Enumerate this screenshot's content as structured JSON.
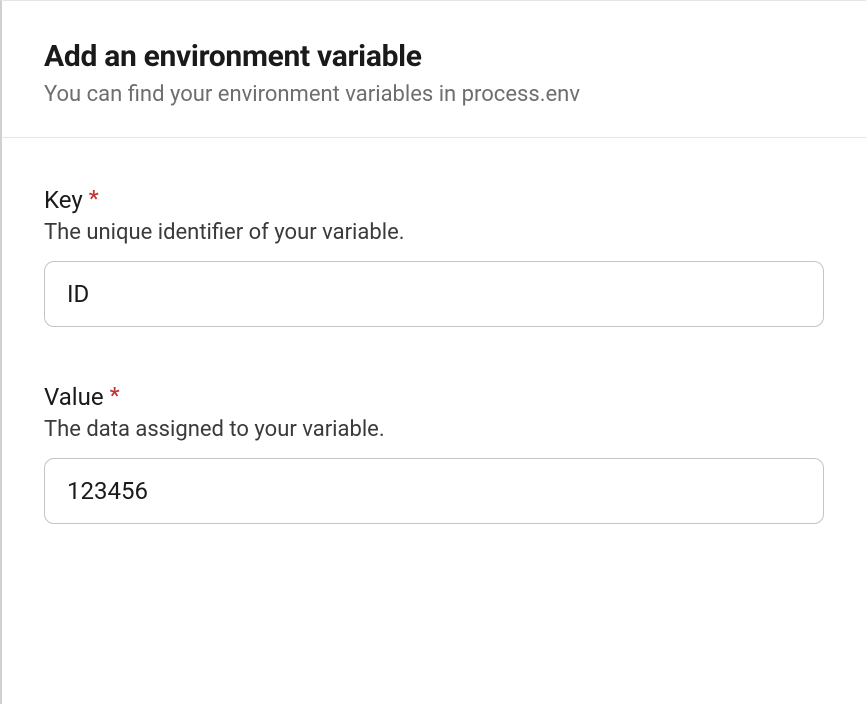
{
  "header": {
    "title": "Add an environment variable",
    "subtitle": "You can find your environment variables in process.env"
  },
  "form": {
    "key": {
      "label": "Key",
      "required_mark": "*",
      "description": "The unique identifier of your variable.",
      "value": "ID"
    },
    "value": {
      "label": "Value",
      "required_mark": "*",
      "description": "The data assigned to your variable.",
      "value": "123456"
    }
  }
}
